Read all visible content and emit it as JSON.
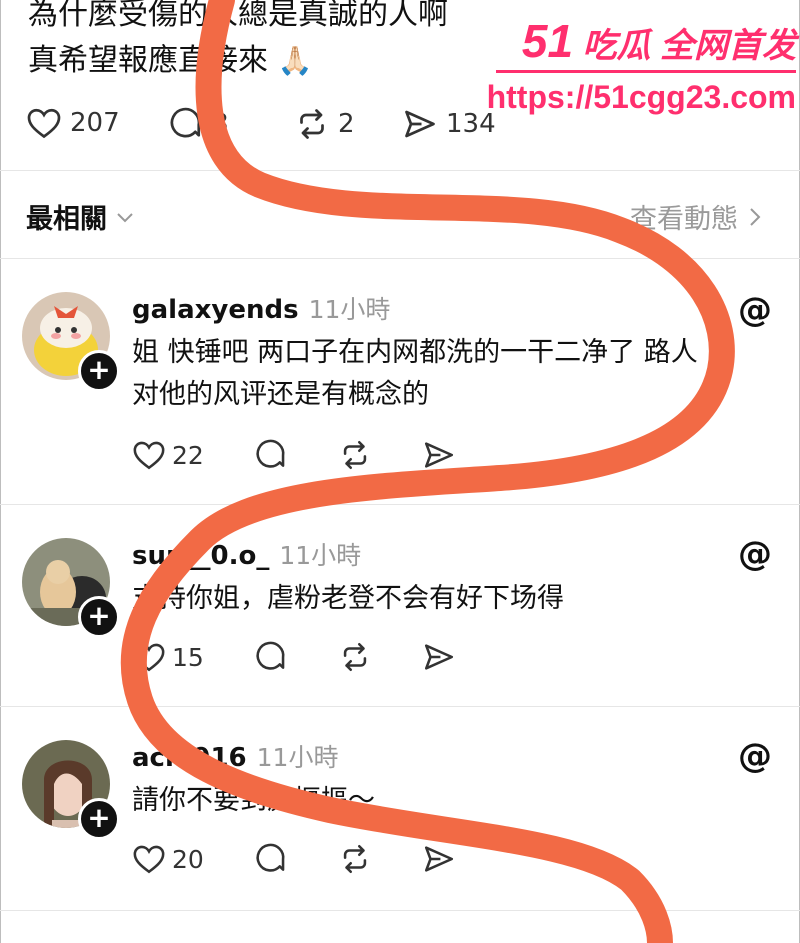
{
  "post": {
    "line1": "為什麼受傷的人總是真誠的人啊",
    "line2": "真希望報應直接來",
    "emoji": "🙏🏻",
    "likes": "207",
    "replies": "8",
    "reposts": "2",
    "shares": "134"
  },
  "sort": {
    "label": "最相關",
    "activity_link": "查看動態"
  },
  "comments": [
    {
      "username": "galaxyends",
      "time": "11小時",
      "text": "姐 快锤吧 两口子在内网都洗的一干二净了 路人\n对他的风评还是有概念的",
      "likes": "22"
    },
    {
      "username": "sun__0.o_",
      "time": "11小時",
      "text": "支持你姐，虐粉老登不会有好下场得",
      "likes": "15"
    },
    {
      "username": "achi916",
      "time": "11小時",
      "text": "請你不要到處摳摳～",
      "likes": "20"
    }
  ],
  "watermark": {
    "brand": "51",
    "title": "吃瓜 全网首发",
    "url": "https://51cgg23.com"
  },
  "colors": {
    "squiggle": "#f26a45",
    "watermark": "#ff2f6e"
  }
}
